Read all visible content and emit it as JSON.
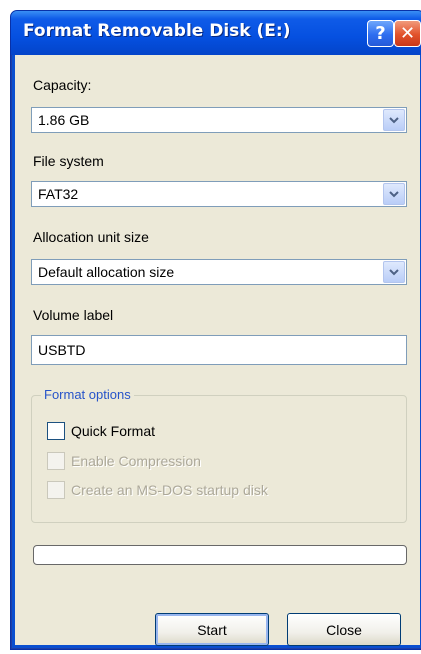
{
  "window": {
    "title": "Format Removable Disk (E:)",
    "help_glyph": "?",
    "close_glyph": "✕"
  },
  "capacity": {
    "label": "Capacity:",
    "value": "1.86 GB"
  },
  "file_system": {
    "label": "File system",
    "value": "FAT32"
  },
  "allocation": {
    "label": "Allocation unit size",
    "value": "Default allocation size"
  },
  "volume": {
    "label": "Volume label",
    "value": "USBTD"
  },
  "format_options": {
    "legend": "Format options",
    "quick_format": "Quick Format",
    "enable_compression": "Enable Compression",
    "msdos_startup": "Create an MS-DOS startup disk"
  },
  "progress": {
    "value": 0
  },
  "buttons": {
    "start": "Start",
    "close": "Close"
  },
  "colors": {
    "titlebar": "#0550e0",
    "dialog_bg": "#ece9d8",
    "legend_text": "#2754c9",
    "close_button": "#e2522b"
  },
  "icons": {
    "dropdown": "chevron-down-icon",
    "help": "help-icon",
    "close": "close-icon"
  }
}
